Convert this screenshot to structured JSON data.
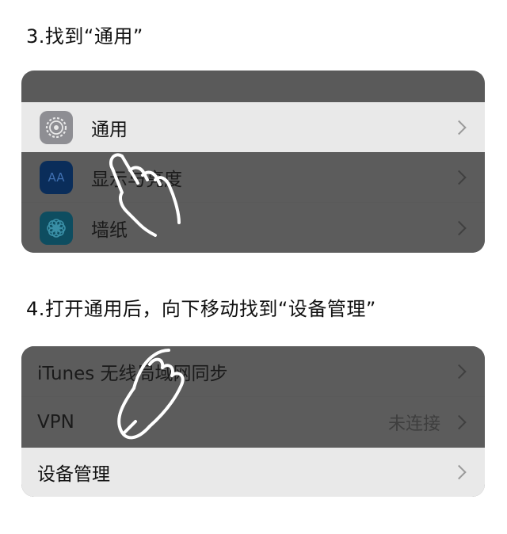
{
  "step3": {
    "title": "3.找到“通用”",
    "rows": [
      {
        "label": "通用",
        "icon": "gear-icon"
      },
      {
        "label": "显示与亮度",
        "icon": "display-brightness-icon",
        "icon_text": "AA"
      },
      {
        "label": "墙纸",
        "icon": "wallpaper-flower-icon"
      }
    ]
  },
  "step4": {
    "title": "4.打开通用后，向下移动找到“设备管理”",
    "rows": [
      {
        "label": "iTunes 无线局域网同步"
      },
      {
        "label": "VPN",
        "value": "未连接"
      },
      {
        "label": "设备管理"
      }
    ]
  },
  "colors": {
    "highlight_row": "#e9e9e9",
    "dimmed_overlay": "#5a5a5a",
    "gear_icon_bg": "#8e8e93",
    "display_icon_bg": "#0a2d5a",
    "wallpaper_icon_bg": "#0e4d60"
  }
}
